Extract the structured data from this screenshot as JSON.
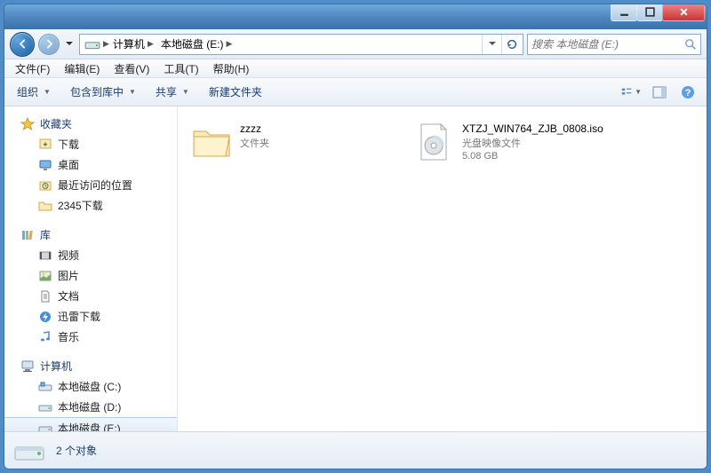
{
  "titlebar": {},
  "nav": {
    "crumbs": [
      "计算机",
      "本地磁盘 (E:)"
    ]
  },
  "search": {
    "placeholder": "搜索 本地磁盘 (E:)"
  },
  "menubar": {
    "file": "文件(F)",
    "edit": "编辑(E)",
    "view": "查看(V)",
    "tools": "工具(T)",
    "help": "帮助(H)"
  },
  "toolbar": {
    "organize": "组织",
    "include_in_library": "包含到库中",
    "share": "共享",
    "new_folder": "新建文件夹"
  },
  "sidebar": {
    "favorites": {
      "label": "收藏夹",
      "items": [
        {
          "label": "下载",
          "icon": "download"
        },
        {
          "label": "桌面",
          "icon": "desktop"
        },
        {
          "label": "最近访问的位置",
          "icon": "recent"
        },
        {
          "label": "2345下载",
          "icon": "folder"
        }
      ]
    },
    "libraries": {
      "label": "库",
      "items": [
        {
          "label": "视频",
          "icon": "video"
        },
        {
          "label": "图片",
          "icon": "pictures"
        },
        {
          "label": "文档",
          "icon": "documents"
        },
        {
          "label": "迅雷下载",
          "icon": "thunder"
        },
        {
          "label": "音乐",
          "icon": "music"
        }
      ]
    },
    "computer": {
      "label": "计算机",
      "items": [
        {
          "label": "本地磁盘 (C:)",
          "icon": "drive-sys"
        },
        {
          "label": "本地磁盘 (D:)",
          "icon": "drive"
        },
        {
          "label": "本地磁盘 (E:)",
          "icon": "drive",
          "selected": true
        }
      ]
    }
  },
  "content": {
    "items": [
      {
        "name": "zzzz",
        "type": "文件夹",
        "icon": "folder"
      },
      {
        "name": "XTZJ_WIN764_ZJB_0808.iso",
        "type": "光盘映像文件",
        "size": "5.08 GB",
        "icon": "iso"
      }
    ]
  },
  "status": {
    "text": "2 个对象"
  }
}
